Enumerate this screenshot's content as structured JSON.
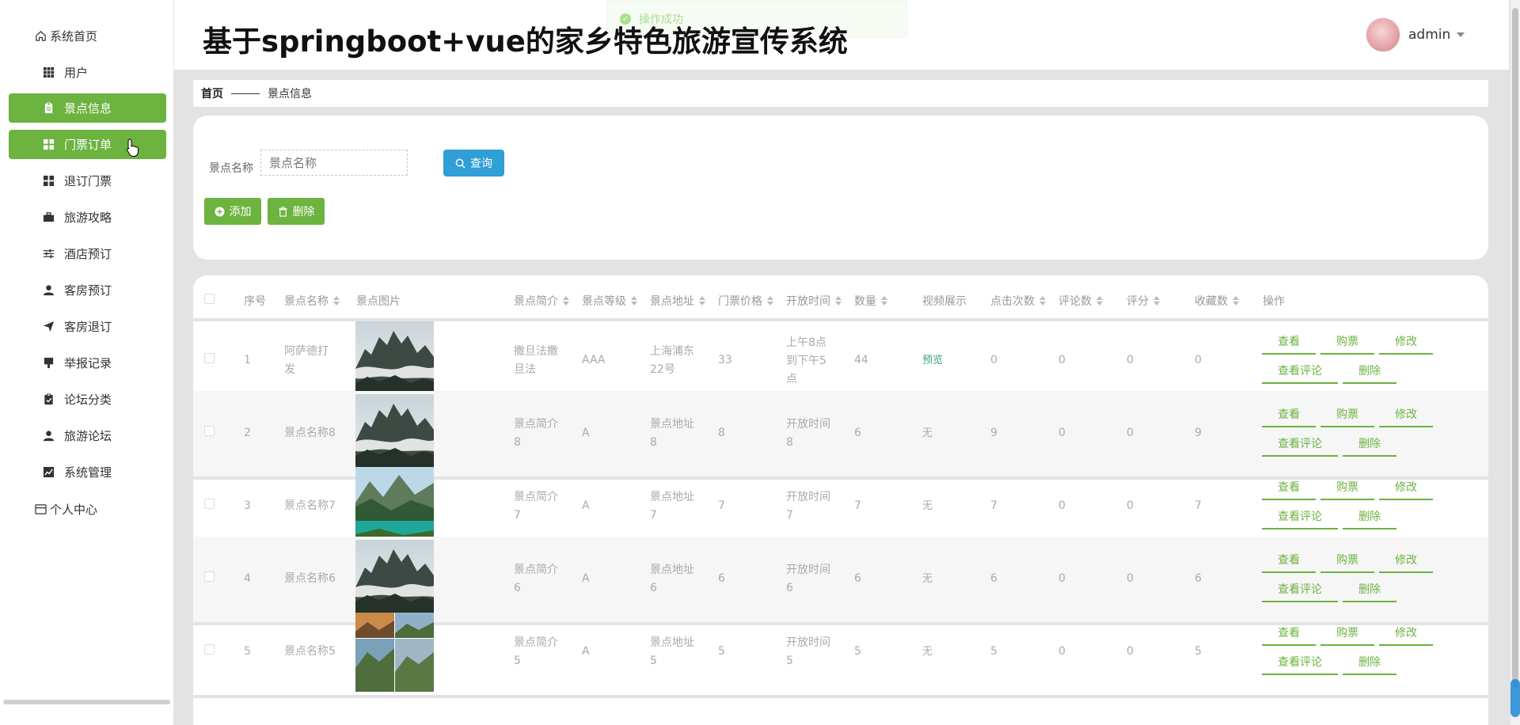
{
  "app": {
    "title": "基于springboot+vue的家乡特色旅游宣传系统",
    "toast": "操作成功",
    "user": "admin"
  },
  "sidebar": {
    "items": [
      {
        "label": "系统首页",
        "icon": "home-icon",
        "active": false
      },
      {
        "label": "用户",
        "icon": "grid-icon",
        "active": false
      },
      {
        "label": "景点信息",
        "icon": "clipboard-icon",
        "active": true
      },
      {
        "label": "门票订单",
        "icon": "apps-icon",
        "active": true
      },
      {
        "label": "退订门票",
        "icon": "apps-icon",
        "active": false
      },
      {
        "label": "旅游攻略",
        "icon": "briefcase-icon",
        "active": false
      },
      {
        "label": "酒店预订",
        "icon": "sliders-icon",
        "active": false
      },
      {
        "label": "客房预订",
        "icon": "person-icon",
        "active": false
      },
      {
        "label": "客房退订",
        "icon": "send-icon",
        "active": false
      },
      {
        "label": "举报记录",
        "icon": "brush-icon",
        "active": false
      },
      {
        "label": "论坛分类",
        "icon": "clipboard-check-icon",
        "active": false
      },
      {
        "label": "旅游论坛",
        "icon": "person-icon",
        "active": false
      },
      {
        "label": "系统管理",
        "icon": "chart-icon",
        "active": false
      },
      {
        "label": "个人中心",
        "icon": "card-icon",
        "active": false
      }
    ]
  },
  "breadcrumb": {
    "home": "首页",
    "current": "景点信息"
  },
  "search": {
    "label": "景点名称",
    "placeholder": "景点名称",
    "query_label": "查询",
    "add_label": "添加",
    "delete_label": "删除"
  },
  "table": {
    "columns": [
      "序号",
      "景点名称",
      "景点图片",
      "景点简介",
      "景点等级",
      "景点地址",
      "门票价格",
      "开放时间",
      "数量",
      "视频展示",
      "点击次数",
      "评论数",
      "评分",
      "收藏数",
      "操作"
    ],
    "actions": {
      "view": "查看",
      "buy": "购票",
      "edit": "修改",
      "comments": "查看评论",
      "delete": "删除"
    },
    "rows": [
      {
        "index": "1",
        "name": "阿萨德打发",
        "image": "mist-mountain",
        "intro": "撒旦法撒旦法",
        "level": "AAA",
        "address": "上海浦东22号",
        "price": "33",
        "open_time": "上午8点到下午5点",
        "quantity": "44",
        "video": "预览",
        "clicks": "0",
        "comments": "0",
        "rating": "0",
        "favorites": "0"
      },
      {
        "index": "2",
        "name": "景点名称8",
        "image": "mist-mountain",
        "intro": "景点简介8",
        "level": "A",
        "address": "景点地址8",
        "price": "8",
        "open_time": "开放时间8",
        "quantity": "6",
        "video": "无",
        "clicks": "9",
        "comments": "0",
        "rating": "0",
        "favorites": "9"
      },
      {
        "index": "3",
        "name": "景点名称7",
        "image": "green-lake",
        "intro": "景点简介7",
        "level": "A",
        "address": "景点地址7",
        "price": "7",
        "open_time": "开放时间7",
        "quantity": "7",
        "video": "无",
        "clicks": "7",
        "comments": "0",
        "rating": "0",
        "favorites": "7"
      },
      {
        "index": "4",
        "name": "景点名称6",
        "image": "mist-mountain",
        "intro": "景点简介6",
        "level": "A",
        "address": "景点地址6",
        "price": "6",
        "open_time": "开放时间6",
        "quantity": "6",
        "video": "无",
        "clicks": "6",
        "comments": "0",
        "rating": "0",
        "favorites": "6"
      },
      {
        "index": "5",
        "name": "景点名称5",
        "image": "great-wall-collage",
        "intro": "景点简介5",
        "level": "A",
        "address": "景点地址5",
        "price": "5",
        "open_time": "开放时间5",
        "quantity": "5",
        "video": "无",
        "clicks": "5",
        "comments": "0",
        "rating": "0",
        "favorites": "5"
      }
    ]
  },
  "colors": {
    "accent": "#6cb33f",
    "query": "#2f9fd6",
    "video_link": "#3aa57a"
  }
}
